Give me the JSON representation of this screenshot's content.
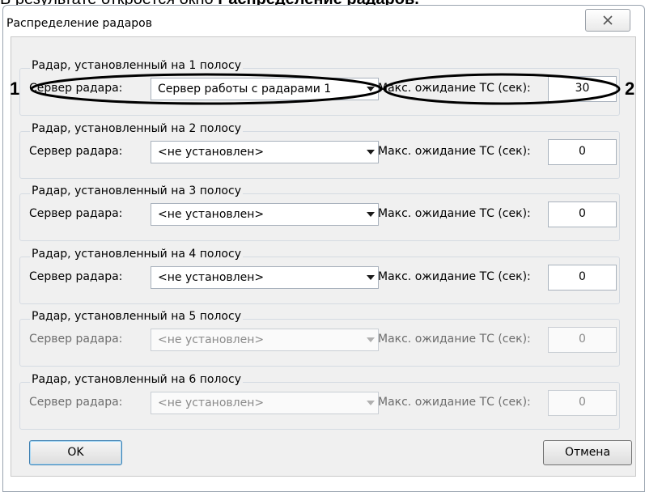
{
  "doc": {
    "prefix": "В результате откроется окно ",
    "bold": "Распределение радаров."
  },
  "dialog": {
    "title": "Распределение радаров",
    "close_icon": "✕"
  },
  "labels": {
    "server": "Сервер радара:",
    "max_wait": "Макс. ожидание ТС (сек):"
  },
  "lanes": [
    {
      "title": "Радар, установленный на 1 полосу",
      "server": "Сервер работы с радарами 1",
      "wait": "30",
      "enabled": true
    },
    {
      "title": "Радар, установленный на 2 полосу",
      "server": "<не установлен>",
      "wait": "0",
      "enabled": true
    },
    {
      "title": "Радар, установленный на 3 полосу",
      "server": "<не установлен>",
      "wait": "0",
      "enabled": true
    },
    {
      "title": "Радар, установленный на 4 полосу",
      "server": "<не установлен>",
      "wait": "0",
      "enabled": true
    },
    {
      "title": "Радар, установленный на 5 полосу",
      "server": "<не установлен>",
      "wait": "0",
      "enabled": false
    },
    {
      "title": "Радар, установленный на 6 полосу",
      "server": "<не установлен>",
      "wait": "0",
      "enabled": false
    }
  ],
  "buttons": {
    "ok": "OK",
    "cancel": "Отмена"
  },
  "markers": {
    "one": "1",
    "two": "2"
  }
}
